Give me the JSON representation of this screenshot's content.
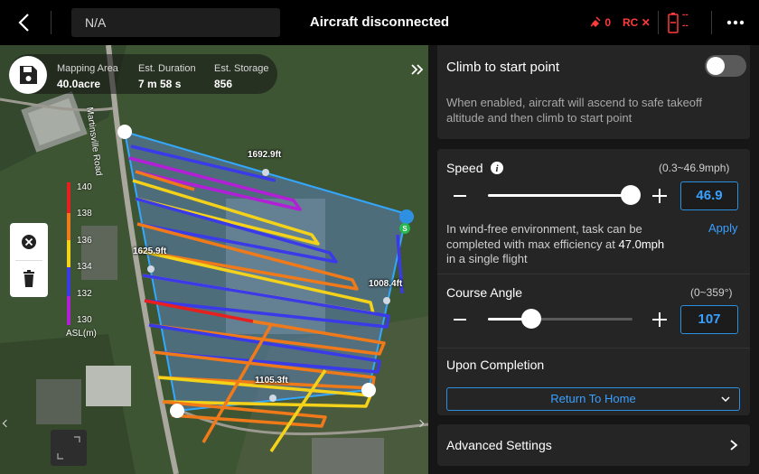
{
  "topbar": {
    "mission_name": "N/A",
    "connection_status": "Aircraft disconnected",
    "gps_count": "0",
    "rc_label": "RC",
    "rc_status": "✕",
    "battery_dash1": "--",
    "battery_dash2": "--"
  },
  "map": {
    "info": [
      {
        "label": "Mapping Area",
        "value": "40.0acre"
      },
      {
        "label": "Est. Duration",
        "value": "7 m 58 s"
      },
      {
        "label": "Est. Storage",
        "value": "856"
      }
    ],
    "road_label": "Martinsville Road",
    "legend": {
      "ticks": [
        "140",
        "138",
        "136",
        "134",
        "132",
        "130"
      ],
      "title": "ASL(m)",
      "colors": [
        "#e81f1f",
        "#f07a1a",
        "#f4d21a",
        "#3a3ae8",
        "#b21fd6"
      ]
    },
    "distances": {
      "top": "1692.9ft",
      "left": "1625.9ft",
      "right": "1008.4ft",
      "bottom": "1105.3ft"
    },
    "start_marker": "S",
    "colors": {
      "boundary": "#33a8ff",
      "waypoint": "#ffffff"
    }
  },
  "settings": {
    "climb": {
      "title": "Climb to start point",
      "enabled": false,
      "description_line1": "When enabled, aircraft will ascend to safe takeoff",
      "description_line2": "altitude and then climb to start point"
    },
    "speed": {
      "title": "Speed",
      "range": "(0.3~46.9mph)",
      "value": "46.9",
      "fraction": 0.99,
      "note_line1": "In wind-free environment, task can be",
      "note_line2_prefix": "completed with max efficiency at ",
      "note_line2_value": "47.0mph",
      "note_line3": "in a single flight",
      "apply_label": "Apply"
    },
    "course_angle": {
      "title": "Course Angle",
      "range": "(0~359°)",
      "value": "107",
      "fraction": 0.3
    },
    "completion": {
      "title": "Upon Completion",
      "selected": "Return To Home"
    },
    "advanced": {
      "title": "Advanced Settings"
    },
    "colors": {
      "accent": "#3aa0ff",
      "panel": "#252525"
    }
  }
}
